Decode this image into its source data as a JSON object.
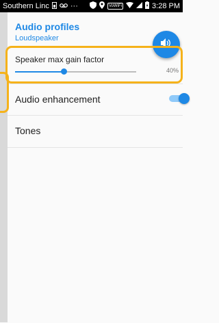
{
  "status_bar": {
    "carrier": "Southern Linc",
    "voicemail_icon": "voicemail-icon",
    "dots": "···",
    "volte": "VoWiFi",
    "time": "3:28 PM"
  },
  "header": {
    "title": "Audio profiles",
    "subtitle": "Loudspeaker"
  },
  "gain": {
    "label": "Speaker max gain factor",
    "value_text": "40%",
    "value": 0.4
  },
  "settings": {
    "enhancement_label": "Audio enhancement",
    "enhancement_on": true,
    "tones_label": "Tones"
  },
  "colors": {
    "accent": "#1e88e5",
    "highlight": "#f5b21a"
  }
}
